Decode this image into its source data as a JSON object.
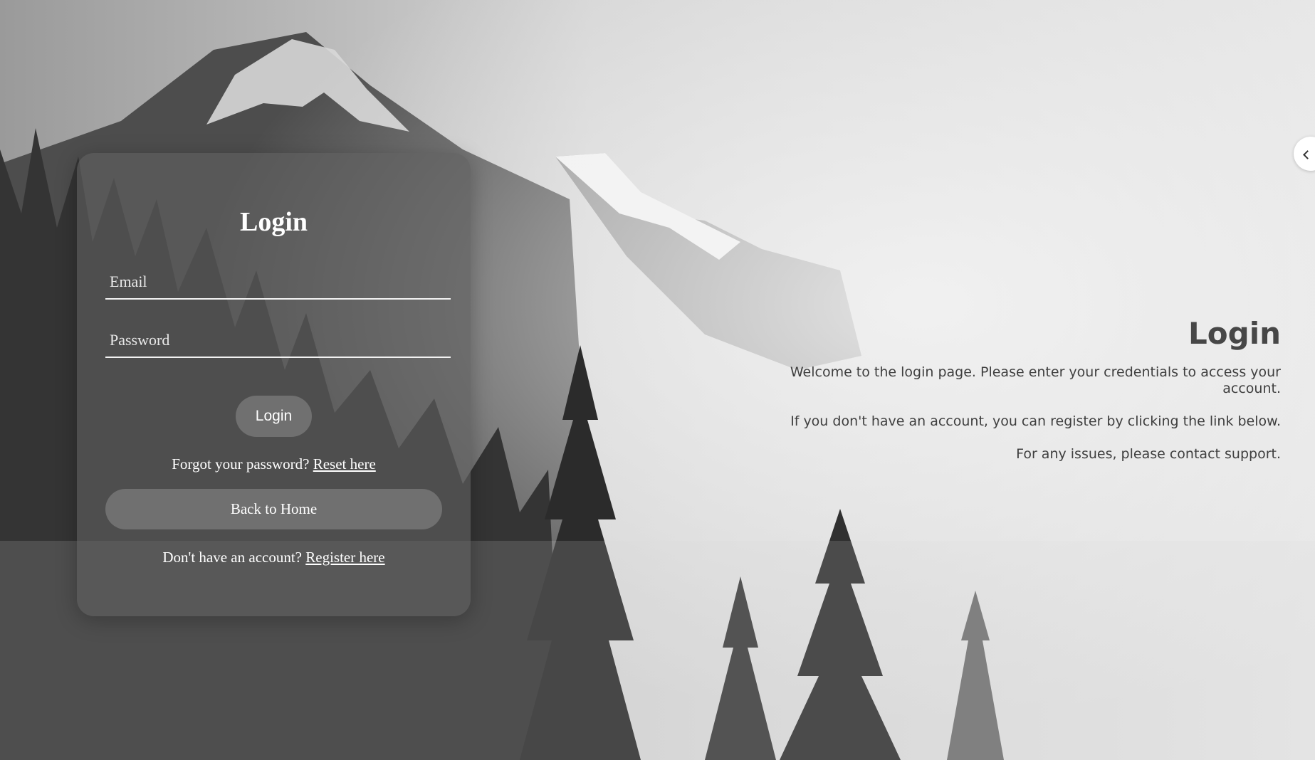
{
  "login_form": {
    "title": "Login",
    "email_placeholder": "Email",
    "password_placeholder": "Password",
    "submit_label": "Login",
    "forgot_text": "Forgot your password? ",
    "reset_link": "Reset here",
    "back_home_label": "Back to Home",
    "register_text": "Don't have an account? ",
    "register_link": "Register here"
  },
  "info_panel": {
    "title": "Login",
    "lines": [
      "Welcome to the login page. Please enter your credentials to access your account.",
      "If you don't have an account, you can register by clicking the link below.",
      "For any issues, please contact support."
    ]
  },
  "side_toggle": {
    "icon": "chevron-left-icon"
  },
  "colors": {
    "card_background": "#5f5f5f",
    "text_on_card": "#ffffff",
    "info_text": "#3f3f3f"
  }
}
